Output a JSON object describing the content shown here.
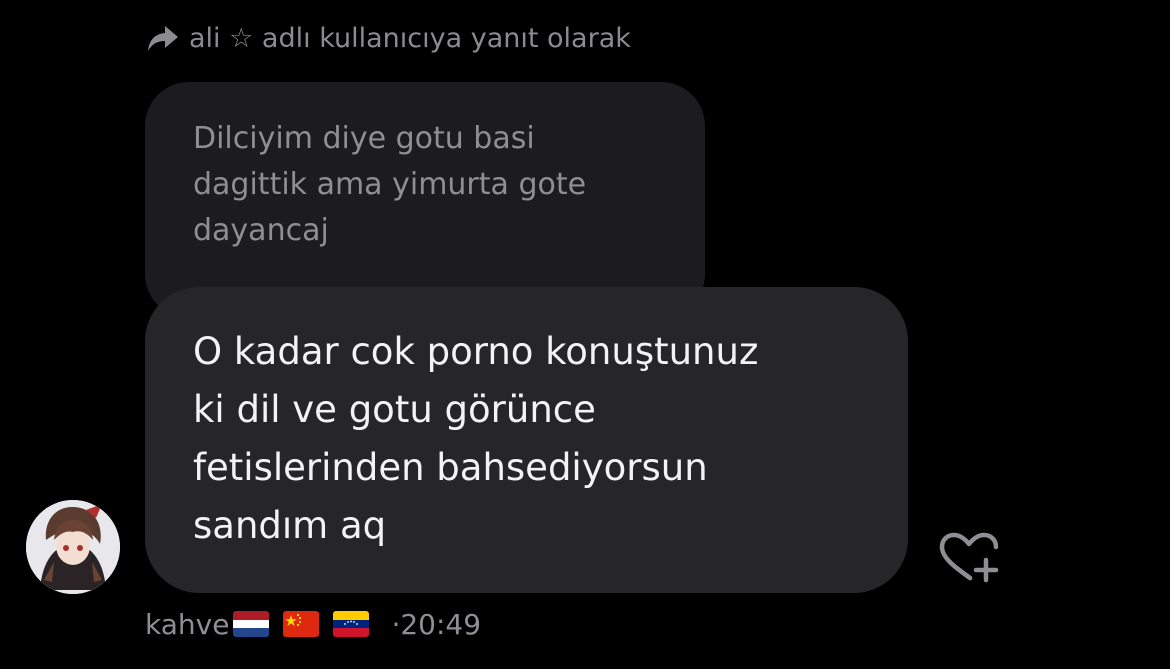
{
  "reply_header": {
    "icon": "reply-arrow-icon",
    "text": "ali ☆ adlı kullanıcıya yanıt olarak"
  },
  "quoted_message": {
    "text": "Dilciyim diye gotu basi\ndagittik ama yimurta gote\ndayancaj"
  },
  "message": {
    "text": "O kadar cok porno konuştunuz\nki dil ve gotu görünce\nfetislerinden bahsediyorsun\nsandım aq"
  },
  "sender": {
    "name": "kahve",
    "flags": [
      "netherlands-flag",
      "china-flag",
      "venezuela-flag"
    ],
    "time": "20:49",
    "separator": "·"
  },
  "actions": {
    "like_icon": "heart-plus-icon"
  },
  "colors": {
    "background": "#000000",
    "main_bubble": "#262628",
    "quoted_bubble": "#1c1c1e",
    "muted_text": "#8e8e93",
    "main_text": "#f2f2f7"
  }
}
